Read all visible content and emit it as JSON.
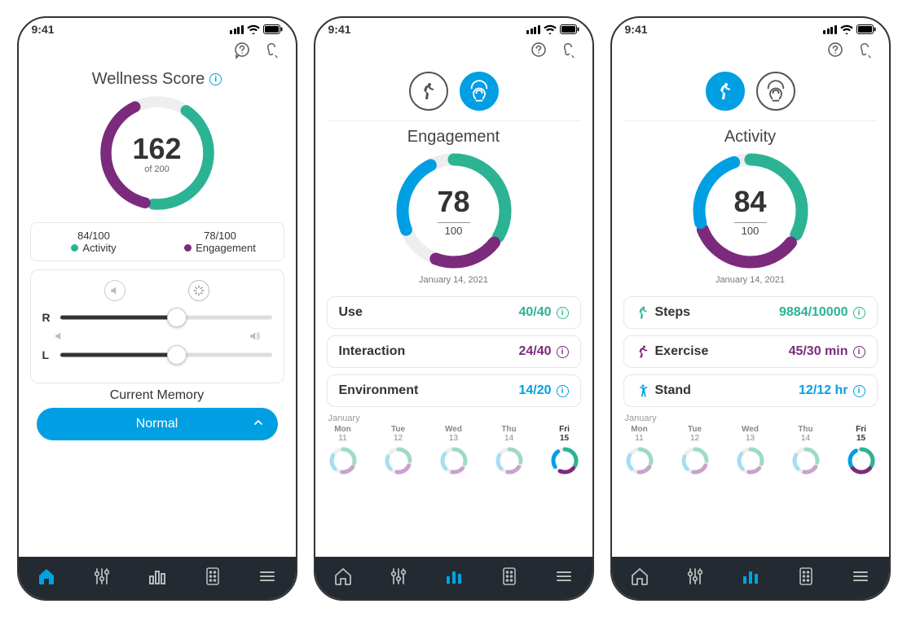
{
  "statusbar": {
    "time": "9:41"
  },
  "screen1": {
    "title": "Wellness Score",
    "score": "162",
    "score_sub": "of 200",
    "activity_score": "84/100",
    "activity_label": "Activity",
    "engagement_score": "78/100",
    "engagement_label": "Engagement",
    "right_label": "R",
    "left_label": "L",
    "memory_title": "Current Memory",
    "memory_value": "Normal"
  },
  "screen2": {
    "title": "Engagement",
    "score": "78",
    "max": "100",
    "date": "January 14, 2021",
    "rows": [
      {
        "label": "Use",
        "value": "40/40",
        "color": "#2bb394"
      },
      {
        "label": "Interaction",
        "value": "24/40",
        "color": "#7c2b7c"
      },
      {
        "label": "Environment",
        "value": "14/20",
        "color": "#009fe3"
      }
    ],
    "cal_month": "January",
    "cal": [
      {
        "dow": "Mon",
        "num": "11"
      },
      {
        "dow": "Tue",
        "num": "12"
      },
      {
        "dow": "Wed",
        "num": "13"
      },
      {
        "dow": "Thu",
        "num": "14"
      },
      {
        "dow": "Fri",
        "num": "15"
      }
    ]
  },
  "screen3": {
    "title": "Activity",
    "score": "84",
    "max": "100",
    "date": "January 14, 2021",
    "rows": [
      {
        "label": "Steps",
        "value": "9884/10000",
        "color": "#2bb394"
      },
      {
        "label": "Exercise",
        "value": "45/30 min",
        "color": "#7c2b7c"
      },
      {
        "label": "Stand",
        "value": "12/12 hr",
        "color": "#009fe3"
      }
    ],
    "cal_month": "January",
    "cal": [
      {
        "dow": "Mon",
        "num": "11"
      },
      {
        "dow": "Tue",
        "num": "12"
      },
      {
        "dow": "Wed",
        "num": "13"
      },
      {
        "dow": "Thu",
        "num": "14"
      },
      {
        "dow": "Fri",
        "num": "15"
      }
    ]
  },
  "chart_data": [
    {
      "type": "pie",
      "title": "Wellness Score",
      "max": 200,
      "value": 162,
      "series": [
        {
          "name": "Activity",
          "value": 84,
          "max": 100
        },
        {
          "name": "Engagement",
          "value": 78,
          "max": 100
        }
      ]
    },
    {
      "type": "pie",
      "title": "Engagement",
      "max": 100,
      "value": 78,
      "series": [
        {
          "name": "Use",
          "value": 40,
          "max": 40
        },
        {
          "name": "Interaction",
          "value": 24,
          "max": 40
        },
        {
          "name": "Environment",
          "value": 14,
          "max": 20
        }
      ]
    },
    {
      "type": "pie",
      "title": "Activity",
      "max": 100,
      "value": 84,
      "series": [
        {
          "name": "Steps",
          "value": 9884,
          "max": 10000
        },
        {
          "name": "Exercise",
          "value": 45,
          "max": 30
        },
        {
          "name": "Stand",
          "value": 12,
          "max": 12
        }
      ]
    }
  ]
}
